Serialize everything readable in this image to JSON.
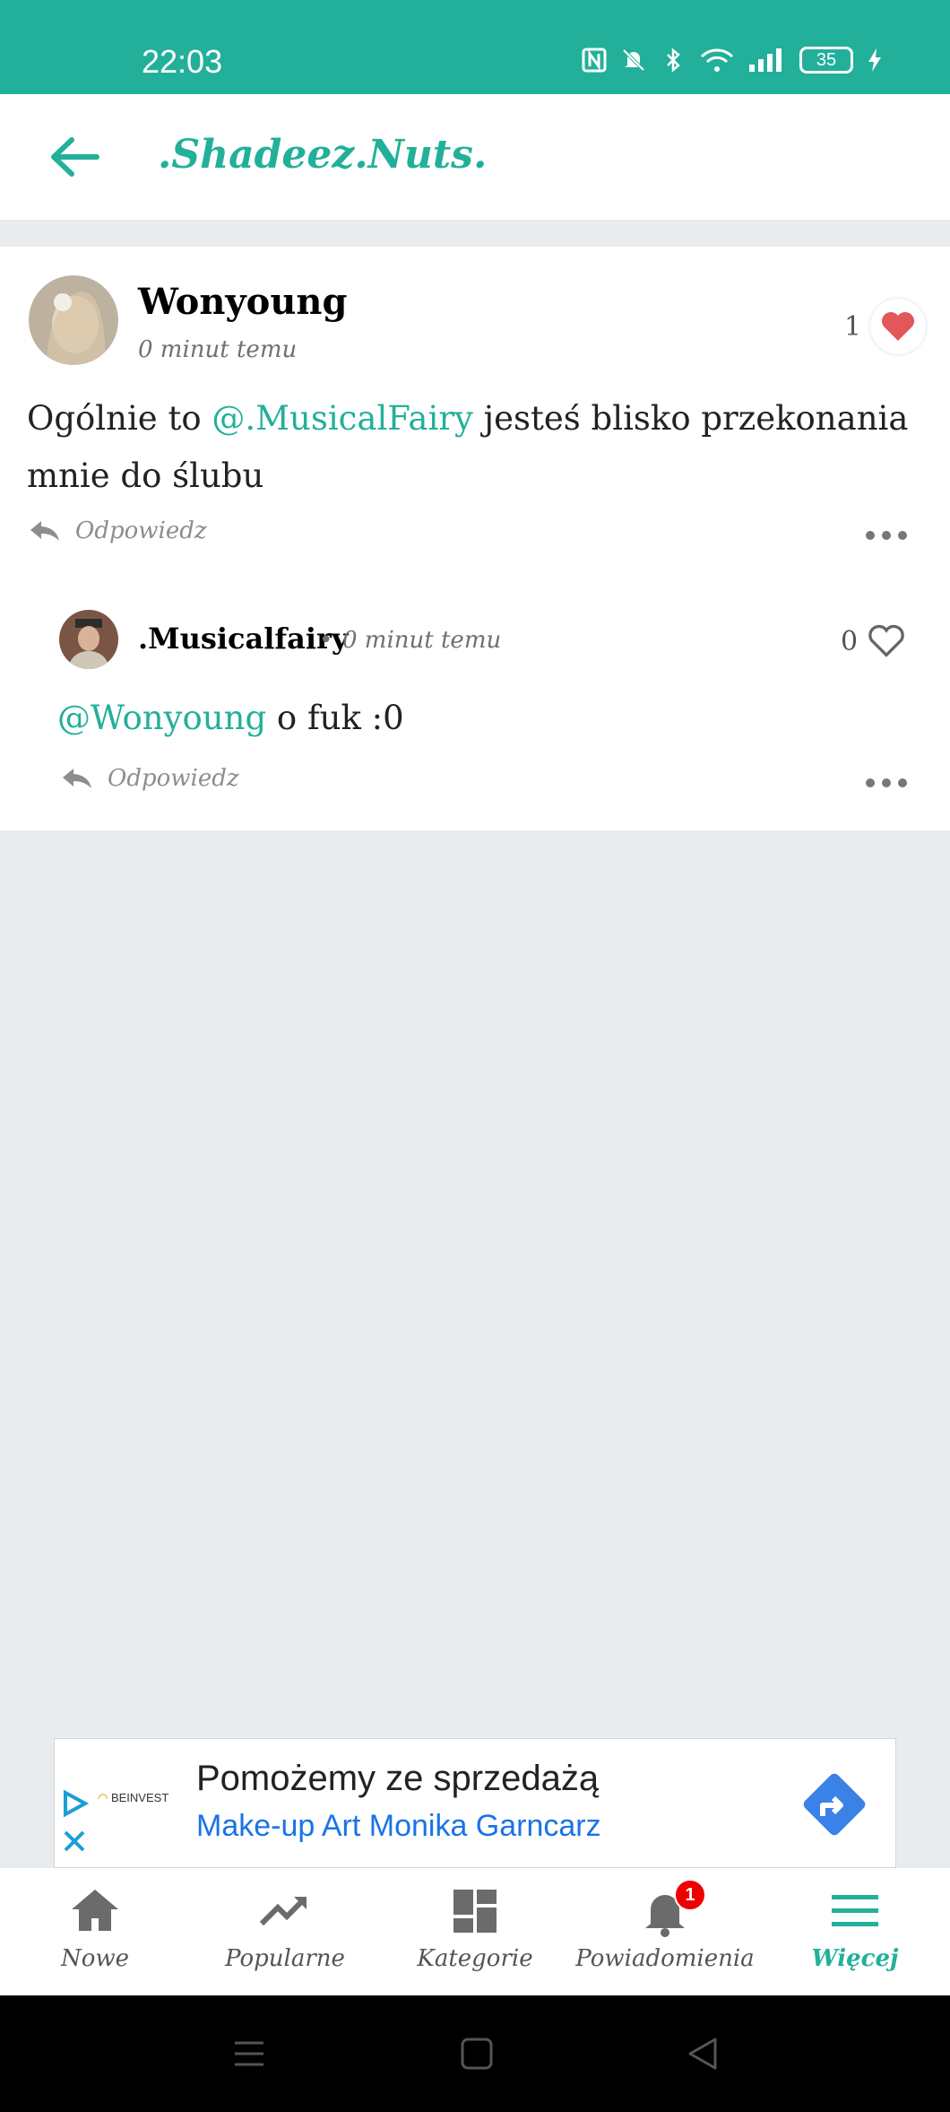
{
  "status": {
    "time": "22:03",
    "battery": "35"
  },
  "header": {
    "title": ".Shadeez.Nuts."
  },
  "post": {
    "author": "Wonyoung",
    "time": "0 minut temu",
    "likes": "1",
    "text_before": "Ogólnie to ",
    "mention": "@.MusicalFairy",
    "text_after": " jesteś blisko przekonania mnie do ślubu",
    "reply_label": "Odpowiedz"
  },
  "comment": {
    "author": ".Musicalfairy",
    "separator": "•",
    "time": "0 minut temu",
    "likes": "0",
    "mention": "@Wonyoung",
    "text": " o fuk :0",
    "reply_label": "Odpowiedz"
  },
  "ad": {
    "headline": "Pomożemy ze sprzedażą",
    "subline": "Make-up Art Monika Garncarz",
    "brand": "BEINVEST"
  },
  "nav": {
    "items": [
      {
        "label": "Nowe",
        "icon": "home-icon"
      },
      {
        "label": "Popularne",
        "icon": "trending-icon"
      },
      {
        "label": "Kategorie",
        "icon": "dashboard-icon"
      },
      {
        "label": "Powiadomienia",
        "icon": "bell-icon",
        "badge": "1"
      },
      {
        "label": "Więcej",
        "icon": "menu-icon",
        "active": true
      }
    ]
  },
  "colors": {
    "accent": "#22b09a",
    "like": "#e2575a"
  }
}
